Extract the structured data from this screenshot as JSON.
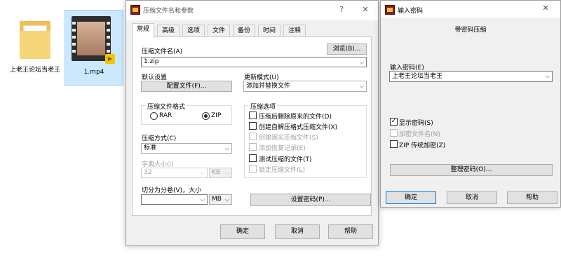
{
  "desktop": {
    "files": [
      {
        "label": "上老王论坛当老王"
      },
      {
        "label": "1.mp4"
      }
    ]
  },
  "archive_dialog": {
    "title": "压缩文件名和参数",
    "help_glyph": "?",
    "close_glyph": "✕",
    "tabs": [
      "常规",
      "高级",
      "选项",
      "文件",
      "备份",
      "时间",
      "注释"
    ],
    "archive_name_label": "压缩文件名(A)",
    "browse_button": "浏览(B)...",
    "archive_name_value": "1.zip",
    "default_settings_label": "默认设置",
    "profiles_button": "配置文件(F)...",
    "update_mode_label": "更新模式(U)",
    "update_mode_value": "添加并替换文件",
    "format_group_title": "压缩文件格式",
    "format_rar": "RAR",
    "format_zip": "ZIP",
    "selected_format": "ZIP",
    "method_label": "压缩方式(C)",
    "method_value": "标准",
    "dict_size_label": "字典大小(I)",
    "dict_size_value": "32",
    "dict_unit_value": "KB",
    "split_label": "切分为分卷(V)，大小",
    "split_value": "",
    "split_unit_value": "MB",
    "options_group_title": "压缩选项",
    "options": [
      {
        "label": "压缩后删除原来的文件(D)",
        "checked": false,
        "enabled": true
      },
      {
        "label": "创建自解压格式压缩文件(X)",
        "checked": false,
        "enabled": true
      },
      {
        "label": "创建固实压缩文件(S)",
        "checked": false,
        "enabled": false
      },
      {
        "label": "添加恢复记录(E)",
        "checked": false,
        "enabled": false
      },
      {
        "label": "测试压缩的文件(T)",
        "checked": false,
        "enabled": true
      },
      {
        "label": "锁定压缩文件(L)",
        "checked": false,
        "enabled": false
      }
    ],
    "set_password_button": "设置密码(P)...",
    "ok_button": "确定",
    "cancel_button": "取消",
    "help_button": "帮助"
  },
  "password_dialog": {
    "title": "输入密码",
    "close_glyph": "✕",
    "subtitle": "带密码压缩",
    "password_label": "输入密码(E)",
    "password_value": "上老王论坛当老王",
    "show_password": "显示密码(S)",
    "show_password_checked": true,
    "encrypt_names": "加密文件名(N)",
    "encrypt_names_checked": false,
    "zip_legacy": "ZIP 传统加密(Z)",
    "zip_legacy_checked": false,
    "organize_button": "整理密码(O)...",
    "ok_button": "确定",
    "cancel_button": "取消",
    "help_button": "帮助"
  },
  "colors": {
    "selection_fill": "#cce8ff",
    "dialog_bg": "#f0f0f0",
    "default_button_border": "#0078d7"
  },
  "icons": [
    "folder-icon",
    "video-file-icon",
    "winrar-app-icon",
    "close-icon",
    "help-icon",
    "chevron-down-icon"
  ]
}
